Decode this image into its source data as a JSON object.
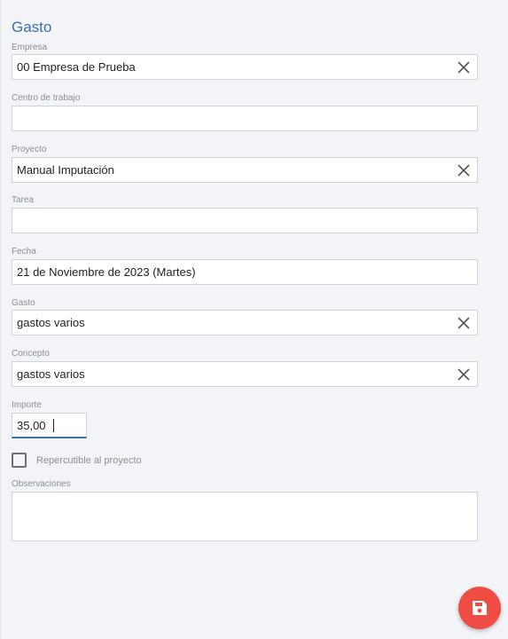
{
  "title": "Gasto",
  "fields": {
    "empresa": {
      "label": "Empresa",
      "value": "00 Empresa de Prueba"
    },
    "centro": {
      "label": "Centro de trabajo",
      "value": ""
    },
    "proyecto": {
      "label": "Proyecto",
      "value": "Manual Imputación"
    },
    "tarea": {
      "label": "Tarea",
      "value": ""
    },
    "fecha": {
      "label": "Fecha",
      "value": "21 de Noviembre de 2023 (Martes)"
    },
    "gasto": {
      "label": "Gasto",
      "value": "gastos varios"
    },
    "concepto": {
      "label": "Concepto",
      "value": "gastos varios"
    },
    "importe": {
      "label": "Importe",
      "value": "35,00"
    },
    "observaciones": {
      "label": "Observaciones",
      "value": ""
    }
  },
  "checkbox": {
    "label": "Repercutible al proyecto",
    "checked": false
  },
  "icons": {
    "clear": "close-icon",
    "save": "floppy-disk-icon"
  },
  "colors": {
    "accent": "#3d6fa8",
    "fab": "#ef4d43",
    "background": "#f2f4f8"
  }
}
